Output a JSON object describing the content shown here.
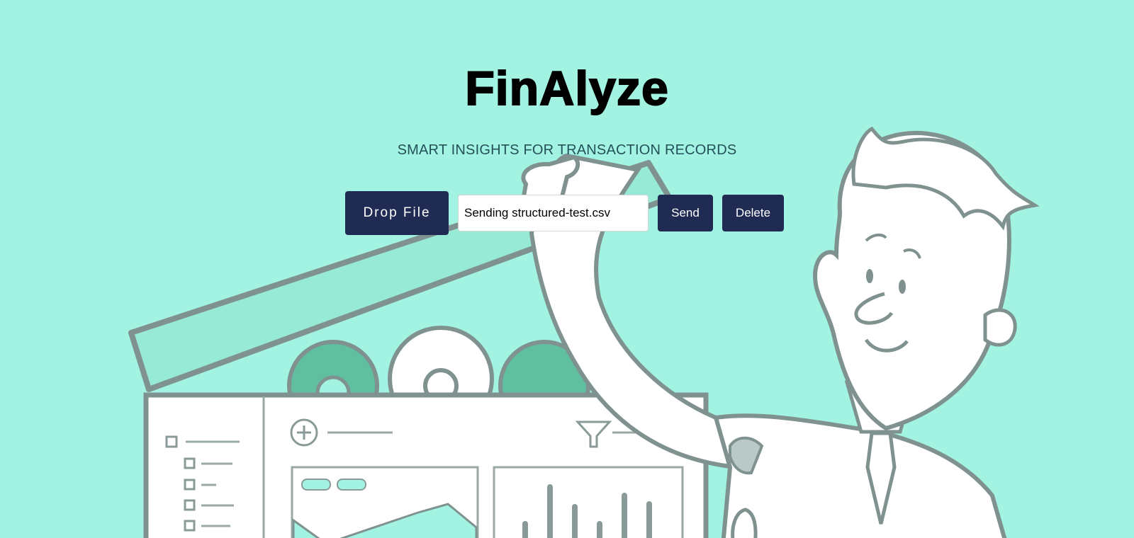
{
  "app": {
    "title": "FinAlyze",
    "subtitle": "SMART INSIGHTS FOR TRANSACTION RECORDS"
  },
  "controls": {
    "drop_label": "Drop File",
    "file_field_value": "Sending structured-test.csv",
    "send_label": "Send",
    "delete_label": "Delete"
  },
  "colors": {
    "background": "#a2f3e2",
    "button": "#1f2b53",
    "illustration_line": "#8a9a98"
  },
  "icons": [
    "plus-circle-icon",
    "filter-icon",
    "gear-icon"
  ]
}
